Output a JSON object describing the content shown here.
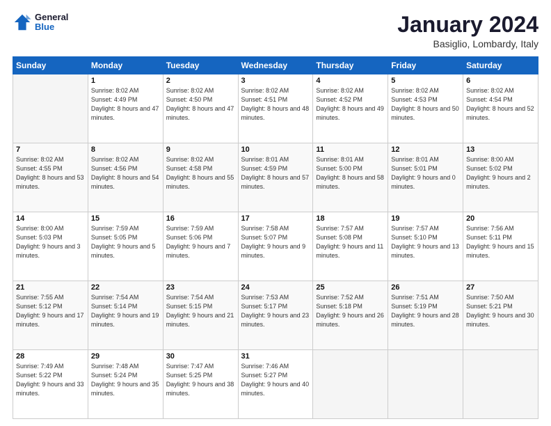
{
  "header": {
    "logo_line1": "General",
    "logo_line2": "Blue",
    "month_title": "January 2024",
    "location": "Basiglio, Lombardy, Italy"
  },
  "days_of_week": [
    "Sunday",
    "Monday",
    "Tuesday",
    "Wednesday",
    "Thursday",
    "Friday",
    "Saturday"
  ],
  "weeks": [
    [
      {
        "day": "",
        "sunrise": "",
        "sunset": "",
        "daylight": ""
      },
      {
        "day": "1",
        "sunrise": "Sunrise: 8:02 AM",
        "sunset": "Sunset: 4:49 PM",
        "daylight": "Daylight: 8 hours and 47 minutes."
      },
      {
        "day": "2",
        "sunrise": "Sunrise: 8:02 AM",
        "sunset": "Sunset: 4:50 PM",
        "daylight": "Daylight: 8 hours and 47 minutes."
      },
      {
        "day": "3",
        "sunrise": "Sunrise: 8:02 AM",
        "sunset": "Sunset: 4:51 PM",
        "daylight": "Daylight: 8 hours and 48 minutes."
      },
      {
        "day": "4",
        "sunrise": "Sunrise: 8:02 AM",
        "sunset": "Sunset: 4:52 PM",
        "daylight": "Daylight: 8 hours and 49 minutes."
      },
      {
        "day": "5",
        "sunrise": "Sunrise: 8:02 AM",
        "sunset": "Sunset: 4:53 PM",
        "daylight": "Daylight: 8 hours and 50 minutes."
      },
      {
        "day": "6",
        "sunrise": "Sunrise: 8:02 AM",
        "sunset": "Sunset: 4:54 PM",
        "daylight": "Daylight: 8 hours and 52 minutes."
      }
    ],
    [
      {
        "day": "7",
        "sunrise": "Sunrise: 8:02 AM",
        "sunset": "Sunset: 4:55 PM",
        "daylight": "Daylight: 8 hours and 53 minutes."
      },
      {
        "day": "8",
        "sunrise": "Sunrise: 8:02 AM",
        "sunset": "Sunset: 4:56 PM",
        "daylight": "Daylight: 8 hours and 54 minutes."
      },
      {
        "day": "9",
        "sunrise": "Sunrise: 8:02 AM",
        "sunset": "Sunset: 4:58 PM",
        "daylight": "Daylight: 8 hours and 55 minutes."
      },
      {
        "day": "10",
        "sunrise": "Sunrise: 8:01 AM",
        "sunset": "Sunset: 4:59 PM",
        "daylight": "Daylight: 8 hours and 57 minutes."
      },
      {
        "day": "11",
        "sunrise": "Sunrise: 8:01 AM",
        "sunset": "Sunset: 5:00 PM",
        "daylight": "Daylight: 8 hours and 58 minutes."
      },
      {
        "day": "12",
        "sunrise": "Sunrise: 8:01 AM",
        "sunset": "Sunset: 5:01 PM",
        "daylight": "Daylight: 9 hours and 0 minutes."
      },
      {
        "day": "13",
        "sunrise": "Sunrise: 8:00 AM",
        "sunset": "Sunset: 5:02 PM",
        "daylight": "Daylight: 9 hours and 2 minutes."
      }
    ],
    [
      {
        "day": "14",
        "sunrise": "Sunrise: 8:00 AM",
        "sunset": "Sunset: 5:03 PM",
        "daylight": "Daylight: 9 hours and 3 minutes."
      },
      {
        "day": "15",
        "sunrise": "Sunrise: 7:59 AM",
        "sunset": "Sunset: 5:05 PM",
        "daylight": "Daylight: 9 hours and 5 minutes."
      },
      {
        "day": "16",
        "sunrise": "Sunrise: 7:59 AM",
        "sunset": "Sunset: 5:06 PM",
        "daylight": "Daylight: 9 hours and 7 minutes."
      },
      {
        "day": "17",
        "sunrise": "Sunrise: 7:58 AM",
        "sunset": "Sunset: 5:07 PM",
        "daylight": "Daylight: 9 hours and 9 minutes."
      },
      {
        "day": "18",
        "sunrise": "Sunrise: 7:57 AM",
        "sunset": "Sunset: 5:08 PM",
        "daylight": "Daylight: 9 hours and 11 minutes."
      },
      {
        "day": "19",
        "sunrise": "Sunrise: 7:57 AM",
        "sunset": "Sunset: 5:10 PM",
        "daylight": "Daylight: 9 hours and 13 minutes."
      },
      {
        "day": "20",
        "sunrise": "Sunrise: 7:56 AM",
        "sunset": "Sunset: 5:11 PM",
        "daylight": "Daylight: 9 hours and 15 minutes."
      }
    ],
    [
      {
        "day": "21",
        "sunrise": "Sunrise: 7:55 AM",
        "sunset": "Sunset: 5:12 PM",
        "daylight": "Daylight: 9 hours and 17 minutes."
      },
      {
        "day": "22",
        "sunrise": "Sunrise: 7:54 AM",
        "sunset": "Sunset: 5:14 PM",
        "daylight": "Daylight: 9 hours and 19 minutes."
      },
      {
        "day": "23",
        "sunrise": "Sunrise: 7:54 AM",
        "sunset": "Sunset: 5:15 PM",
        "daylight": "Daylight: 9 hours and 21 minutes."
      },
      {
        "day": "24",
        "sunrise": "Sunrise: 7:53 AM",
        "sunset": "Sunset: 5:17 PM",
        "daylight": "Daylight: 9 hours and 23 minutes."
      },
      {
        "day": "25",
        "sunrise": "Sunrise: 7:52 AM",
        "sunset": "Sunset: 5:18 PM",
        "daylight": "Daylight: 9 hours and 26 minutes."
      },
      {
        "day": "26",
        "sunrise": "Sunrise: 7:51 AM",
        "sunset": "Sunset: 5:19 PM",
        "daylight": "Daylight: 9 hours and 28 minutes."
      },
      {
        "day": "27",
        "sunrise": "Sunrise: 7:50 AM",
        "sunset": "Sunset: 5:21 PM",
        "daylight": "Daylight: 9 hours and 30 minutes."
      }
    ],
    [
      {
        "day": "28",
        "sunrise": "Sunrise: 7:49 AM",
        "sunset": "Sunset: 5:22 PM",
        "daylight": "Daylight: 9 hours and 33 minutes."
      },
      {
        "day": "29",
        "sunrise": "Sunrise: 7:48 AM",
        "sunset": "Sunset: 5:24 PM",
        "daylight": "Daylight: 9 hours and 35 minutes."
      },
      {
        "day": "30",
        "sunrise": "Sunrise: 7:47 AM",
        "sunset": "Sunset: 5:25 PM",
        "daylight": "Daylight: 9 hours and 38 minutes."
      },
      {
        "day": "31",
        "sunrise": "Sunrise: 7:46 AM",
        "sunset": "Sunset: 5:27 PM",
        "daylight": "Daylight: 9 hours and 40 minutes."
      },
      {
        "day": "",
        "sunrise": "",
        "sunset": "",
        "daylight": ""
      },
      {
        "day": "",
        "sunrise": "",
        "sunset": "",
        "daylight": ""
      },
      {
        "day": "",
        "sunrise": "",
        "sunset": "",
        "daylight": ""
      }
    ]
  ]
}
